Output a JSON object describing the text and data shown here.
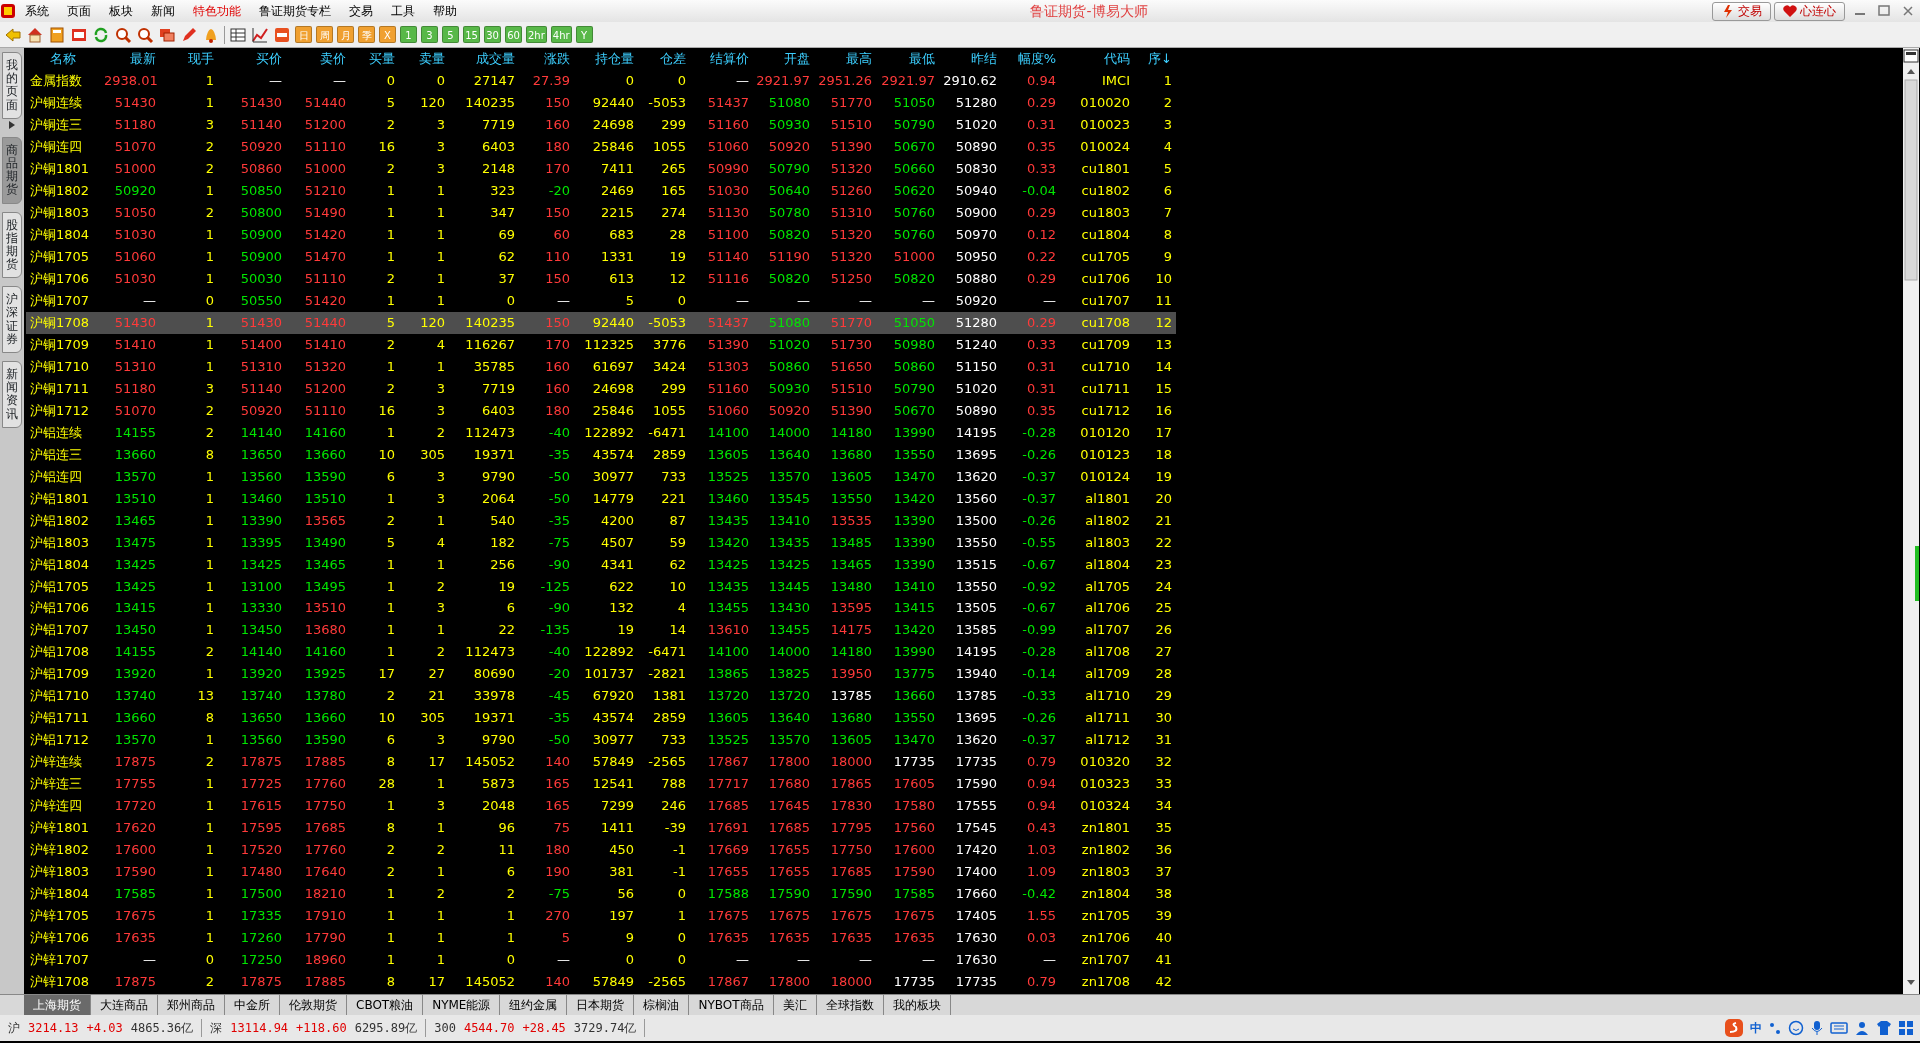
{
  "menu": [
    {
      "label": "系统",
      "selected": false
    },
    {
      "label": "页面",
      "selected": false
    },
    {
      "label": "板块",
      "selected": false
    },
    {
      "label": "新闻",
      "selected": false
    },
    {
      "label": "特色功能",
      "selected": true
    },
    {
      "label": "鲁证期货专栏",
      "selected": false
    },
    {
      "label": "交易",
      "selected": false
    },
    {
      "label": "工具",
      "selected": false
    },
    {
      "label": "帮助",
      "selected": false
    }
  ],
  "window": {
    "title": "鲁证期货-博易大师"
  },
  "title_buttons": [
    "交易",
    "心连心"
  ],
  "toolbar_periods": [
    {
      "label": "日",
      "color": "#f0a030"
    },
    {
      "label": "周",
      "color": "#f0a030"
    },
    {
      "label": "月",
      "color": "#f0a030"
    },
    {
      "label": "季",
      "color": "#f0a030"
    },
    {
      "label": "X",
      "color": "#f0a030"
    },
    {
      "label": "1",
      "color": "#58b848"
    },
    {
      "label": "3",
      "color": "#58b848"
    },
    {
      "label": "5",
      "color": "#58b848"
    },
    {
      "label": "15",
      "color": "#58b848"
    },
    {
      "label": "30",
      "color": "#58b848"
    },
    {
      "label": "60",
      "color": "#58b848"
    },
    {
      "label": "2hr",
      "color": "#58b848"
    },
    {
      "label": "4hr",
      "color": "#58b848"
    },
    {
      "label": "Y",
      "color": "#58b848"
    }
  ],
  "side_tabs": [
    {
      "label": "我的页面",
      "selected": false
    },
    {
      "label": "商品期货",
      "selected": true
    },
    {
      "label": "股指期货",
      "selected": false
    },
    {
      "label": "沪深证券",
      "selected": false
    },
    {
      "label": "新闻资讯",
      "selected": false
    }
  ],
  "table": {
    "columns": [
      "名称",
      "最新",
      "现手",
      "买价",
      "卖价",
      "买量",
      "卖量",
      "成交量",
      "涨跌",
      "持仓量",
      "仓差",
      "结算价",
      "开盘",
      "最高",
      "最低",
      "昨结",
      "幅度%",
      "代码",
      "序↓"
    ],
    "rows": [
      {
        "cells": [
          "金属指数",
          "2938.01",
          "1",
          "—",
          "—",
          "0",
          "0",
          "27147",
          "27.39",
          "0",
          "0",
          "—",
          "2921.97",
          "2951.26",
          "2921.97",
          "2910.62",
          "0.94",
          "IMCI",
          "1"
        ],
        "selected": false
      },
      {
        "cells": [
          "沪铜连续",
          "51430",
          "1",
          "51430",
          "51440",
          "5",
          "120",
          "140235",
          "150",
          "92440",
          "-5053",
          "51437",
          "51080",
          "51770",
          "51050",
          "51280",
          "0.29",
          "010020",
          "2"
        ],
        "selected": false
      },
      {
        "cells": [
          "沪铜连三",
          "51180",
          "3",
          "51140",
          "51200",
          "2",
          "3",
          "7719",
          "160",
          "24698",
          "299",
          "51160",
          "50930",
          "51510",
          "50790",
          "51020",
          "0.31",
          "010023",
          "3"
        ],
        "selected": false
      },
      {
        "cells": [
          "沪铜连四",
          "51070",
          "2",
          "50920",
          "51110",
          "16",
          "3",
          "6403",
          "180",
          "25846",
          "1055",
          "51060",
          "50920",
          "51390",
          "50670",
          "50890",
          "0.35",
          "010024",
          "4"
        ],
        "selected": false
      },
      {
        "cells": [
          "沪铜1801",
          "51000",
          "2",
          "50860",
          "51000",
          "2",
          "3",
          "2148",
          "170",
          "7411",
          "265",
          "50990",
          "50790",
          "51320",
          "50660",
          "50830",
          "0.33",
          "cu1801",
          "5"
        ],
        "selected": false
      },
      {
        "cells": [
          "沪铜1802",
          "50920",
          "1",
          "50850",
          "51210",
          "1",
          "1",
          "323",
          "-20",
          "2469",
          "165",
          "51030",
          "50640",
          "51260",
          "50620",
          "50940",
          "-0.04",
          "cu1802",
          "6"
        ],
        "selected": false
      },
      {
        "cells": [
          "沪铜1803",
          "51050",
          "2",
          "50800",
          "51490",
          "1",
          "1",
          "347",
          "150",
          "2215",
          "274",
          "51130",
          "50780",
          "51310",
          "50760",
          "50900",
          "0.29",
          "cu1803",
          "7"
        ],
        "selected": false
      },
      {
        "cells": [
          "沪铜1804",
          "51030",
          "1",
          "50900",
          "51420",
          "1",
          "1",
          "69",
          "60",
          "683",
          "28",
          "51100",
          "50820",
          "51320",
          "50760",
          "50970",
          "0.12",
          "cu1804",
          "8"
        ],
        "selected": false
      },
      {
        "cells": [
          "沪铜1705",
          "51060",
          "1",
          "50900",
          "51470",
          "1",
          "1",
          "62",
          "110",
          "1331",
          "19",
          "51140",
          "51190",
          "51320",
          "51000",
          "50950",
          "0.22",
          "cu1705",
          "9"
        ],
        "selected": false
      },
      {
        "cells": [
          "沪铜1706",
          "51030",
          "1",
          "50030",
          "51110",
          "2",
          "1",
          "37",
          "150",
          "613",
          "12",
          "51116",
          "50820",
          "51250",
          "50820",
          "50880",
          "0.29",
          "cu1706",
          "10"
        ],
        "selected": false
      },
      {
        "cells": [
          "沪铜1707",
          "—",
          "0",
          "50550",
          "51420",
          "1",
          "1",
          "0",
          "—",
          "5",
          "0",
          "—",
          "—",
          "—",
          "—",
          "50920",
          "—",
          "cu1707",
          "11"
        ],
        "selected": false
      },
      {
        "cells": [
          "沪铜1708",
          "51430",
          "1",
          "51430",
          "51440",
          "5",
          "120",
          "140235",
          "150",
          "92440",
          "-5053",
          "51437",
          "51080",
          "51770",
          "51050",
          "51280",
          "0.29",
          "cu1708",
          "12"
        ],
        "selected": true
      },
      {
        "cells": [
          "沪铜1709",
          "51410",
          "1",
          "51400",
          "51410",
          "2",
          "4",
          "116267",
          "170",
          "112325",
          "3776",
          "51390",
          "51020",
          "51730",
          "50980",
          "51240",
          "0.33",
          "cu1709",
          "13"
        ],
        "selected": false
      },
      {
        "cells": [
          "沪铜1710",
          "51310",
          "1",
          "51310",
          "51320",
          "1",
          "1",
          "35785",
          "160",
          "61697",
          "3424",
          "51303",
          "50860",
          "51650",
          "50860",
          "51150",
          "0.31",
          "cu1710",
          "14"
        ],
        "selected": false
      },
      {
        "cells": [
          "沪铜1711",
          "51180",
          "3",
          "51140",
          "51200",
          "2",
          "3",
          "7719",
          "160",
          "24698",
          "299",
          "51160",
          "50930",
          "51510",
          "50790",
          "51020",
          "0.31",
          "cu1711",
          "15"
        ],
        "selected": false
      },
      {
        "cells": [
          "沪铜1712",
          "51070",
          "2",
          "50920",
          "51110",
          "16",
          "3",
          "6403",
          "180",
          "25846",
          "1055",
          "51060",
          "50920",
          "51390",
          "50670",
          "50890",
          "0.35",
          "cu1712",
          "16"
        ],
        "selected": false
      },
      {
        "cells": [
          "沪铝连续",
          "14155",
          "2",
          "14140",
          "14160",
          "1",
          "2",
          "112473",
          "-40",
          "122892",
          "-6471",
          "14100",
          "14000",
          "14180",
          "13990",
          "14195",
          "-0.28",
          "010120",
          "17"
        ],
        "selected": false
      },
      {
        "cells": [
          "沪铝连三",
          "13660",
          "8",
          "13650",
          "13660",
          "10",
          "305",
          "19371",
          "-35",
          "43574",
          "2859",
          "13605",
          "13640",
          "13680",
          "13550",
          "13695",
          "-0.26",
          "010123",
          "18"
        ],
        "selected": false
      },
      {
        "cells": [
          "沪铝连四",
          "13570",
          "1",
          "13560",
          "13590",
          "6",
          "3",
          "9790",
          "-50",
          "30977",
          "733",
          "13525",
          "13570",
          "13605",
          "13470",
          "13620",
          "-0.37",
          "010124",
          "19"
        ],
        "selected": false
      },
      {
        "cells": [
          "沪铝1801",
          "13510",
          "1",
          "13460",
          "13510",
          "1",
          "3",
          "2064",
          "-50",
          "14779",
          "221",
          "13460",
          "13545",
          "13550",
          "13420",
          "13560",
          "-0.37",
          "al1801",
          "20"
        ],
        "selected": false
      },
      {
        "cells": [
          "沪铝1802",
          "13465",
          "1",
          "13390",
          "13565",
          "2",
          "1",
          "540",
          "-35",
          "4200",
          "87",
          "13435",
          "13410",
          "13535",
          "13390",
          "13500",
          "-0.26",
          "al1802",
          "21"
        ],
        "selected": false
      },
      {
        "cells": [
          "沪铝1803",
          "13475",
          "1",
          "13395",
          "13490",
          "5",
          "4",
          "182",
          "-75",
          "4507",
          "59",
          "13420",
          "13435",
          "13485",
          "13390",
          "13550",
          "-0.55",
          "al1803",
          "22"
        ],
        "selected": false
      },
      {
        "cells": [
          "沪铝1804",
          "13425",
          "1",
          "13425",
          "13465",
          "1",
          "1",
          "256",
          "-90",
          "4341",
          "62",
          "13425",
          "13425",
          "13465",
          "13390",
          "13515",
          "-0.67",
          "al1804",
          "23"
        ],
        "selected": false
      },
      {
        "cells": [
          "沪铝1705",
          "13425",
          "1",
          "13100",
          "13495",
          "1",
          "2",
          "19",
          "-125",
          "622",
          "10",
          "13435",
          "13445",
          "13480",
          "13410",
          "13550",
          "-0.92",
          "al1705",
          "24"
        ],
        "selected": false
      },
      {
        "cells": [
          "沪铝1706",
          "13415",
          "1",
          "13330",
          "13510",
          "1",
          "3",
          "6",
          "-90",
          "132",
          "4",
          "13455",
          "13430",
          "13595",
          "13415",
          "13505",
          "-0.67",
          "al1706",
          "25"
        ],
        "selected": false
      },
      {
        "cells": [
          "沪铝1707",
          "13450",
          "1",
          "13450",
          "13680",
          "1",
          "1",
          "22",
          "-135",
          "19",
          "14",
          "13610",
          "13455",
          "14175",
          "13420",
          "13585",
          "-0.99",
          "al1707",
          "26"
        ],
        "selected": false
      },
      {
        "cells": [
          "沪铝1708",
          "14155",
          "2",
          "14140",
          "14160",
          "1",
          "2",
          "112473",
          "-40",
          "122892",
          "-6471",
          "14100",
          "14000",
          "14180",
          "13990",
          "14195",
          "-0.28",
          "al1708",
          "27"
        ],
        "selected": false
      },
      {
        "cells": [
          "沪铝1709",
          "13920",
          "1",
          "13920",
          "13925",
          "17",
          "27",
          "80690",
          "-20",
          "101737",
          "-2821",
          "13865",
          "13825",
          "13950",
          "13775",
          "13940",
          "-0.14",
          "al1709",
          "28"
        ],
        "selected": false
      },
      {
        "cells": [
          "沪铝1710",
          "13740",
          "13",
          "13740",
          "13780",
          "2",
          "21",
          "33978",
          "-45",
          "67920",
          "1381",
          "13720",
          "13720",
          "13785",
          "13660",
          "13785",
          "-0.33",
          "al1710",
          "29"
        ],
        "selected": false
      },
      {
        "cells": [
          "沪铝1711",
          "13660",
          "8",
          "13650",
          "13660",
          "10",
          "305",
          "19371",
          "-35",
          "43574",
          "2859",
          "13605",
          "13640",
          "13680",
          "13550",
          "13695",
          "-0.26",
          "al1711",
          "30"
        ],
        "selected": false
      },
      {
        "cells": [
          "沪铝1712",
          "13570",
          "1",
          "13560",
          "13590",
          "6",
          "3",
          "9790",
          "-50",
          "30977",
          "733",
          "13525",
          "13570",
          "13605",
          "13470",
          "13620",
          "-0.37",
          "al1712",
          "31"
        ],
        "selected": false
      },
      {
        "cells": [
          "沪锌连续",
          "17875",
          "2",
          "17875",
          "17885",
          "8",
          "17",
          "145052",
          "140",
          "57849",
          "-2565",
          "17867",
          "17800",
          "18000",
          "17735",
          "17735",
          "0.79",
          "010320",
          "32"
        ],
        "selected": false
      },
      {
        "cells": [
          "沪锌连三",
          "17755",
          "1",
          "17725",
          "17760",
          "28",
          "1",
          "5873",
          "165",
          "12541",
          "788",
          "17717",
          "17680",
          "17865",
          "17605",
          "17590",
          "0.94",
          "010323",
          "33"
        ],
        "selected": false
      },
      {
        "cells": [
          "沪锌连四",
          "17720",
          "1",
          "17615",
          "17750",
          "1",
          "3",
          "2048",
          "165",
          "7299",
          "246",
          "17685",
          "17645",
          "17830",
          "17580",
          "17555",
          "0.94",
          "010324",
          "34"
        ],
        "selected": false
      },
      {
        "cells": [
          "沪锌1801",
          "17620",
          "1",
          "17595",
          "17685",
          "8",
          "1",
          "96",
          "75",
          "1411",
          "-39",
          "17691",
          "17685",
          "17795",
          "17560",
          "17545",
          "0.43",
          "zn1801",
          "35"
        ],
        "selected": false
      },
      {
        "cells": [
          "沪锌1802",
          "17600",
          "1",
          "17520",
          "17760",
          "2",
          "2",
          "11",
          "180",
          "450",
          "-1",
          "17669",
          "17655",
          "17750",
          "17600",
          "17420",
          "1.03",
          "zn1802",
          "36"
        ],
        "selected": false
      },
      {
        "cells": [
          "沪锌1803",
          "17590",
          "1",
          "17480",
          "17640",
          "2",
          "1",
          "6",
          "190",
          "381",
          "-1",
          "17655",
          "17655",
          "17685",
          "17590",
          "17400",
          "1.09",
          "zn1803",
          "37"
        ],
        "selected": false
      },
      {
        "cells": [
          "沪锌1804",
          "17585",
          "1",
          "17500",
          "18210",
          "1",
          "2",
          "2",
          "-75",
          "56",
          "0",
          "17588",
          "17590",
          "17590",
          "17585",
          "17660",
          "-0.42",
          "zn1804",
          "38"
        ],
        "selected": false
      },
      {
        "cells": [
          "沪锌1705",
          "17675",
          "1",
          "17335",
          "17910",
          "1",
          "1",
          "1",
          "270",
          "197",
          "1",
          "17675",
          "17675",
          "17675",
          "17675",
          "17405",
          "1.55",
          "zn1705",
          "39"
        ],
        "selected": false
      },
      {
        "cells": [
          "沪锌1706",
          "17635",
          "1",
          "17260",
          "17790",
          "1",
          "1",
          "1",
          "5",
          "9",
          "0",
          "17635",
          "17635",
          "17635",
          "17635",
          "17630",
          "0.03",
          "zn1706",
          "40"
        ],
        "selected": false
      },
      {
        "cells": [
          "沪锌1707",
          "—",
          "0",
          "17250",
          "18960",
          "1",
          "1",
          "0",
          "—",
          "0",
          "0",
          "—",
          "—",
          "—",
          "—",
          "17630",
          "—",
          "zn1707",
          "41"
        ],
        "selected": false
      },
      {
        "cells": [
          "沪锌1708",
          "17875",
          "2",
          "17875",
          "17885",
          "8",
          "17",
          "145052",
          "140",
          "57849",
          "-2565",
          "17867",
          "17800",
          "18000",
          "17735",
          "17735",
          "0.79",
          "zn1708",
          "42"
        ],
        "selected": false
      }
    ]
  },
  "bottom_tabs": [
    {
      "label": "上海期货",
      "selected": true
    },
    {
      "label": "大连商品",
      "selected": false
    },
    {
      "label": "郑州商品",
      "selected": false
    },
    {
      "label": "中金所",
      "selected": false
    },
    {
      "label": "伦敦期货",
      "selected": false
    },
    {
      "label": "CBOT粮油",
      "selected": false
    },
    {
      "label": "NYME能源",
      "selected": false
    },
    {
      "label": "纽约金属",
      "selected": false
    },
    {
      "label": "日本期货",
      "selected": false
    },
    {
      "label": "棕榈油",
      "selected": false
    },
    {
      "label": "NYBOT商品",
      "selected": false
    },
    {
      "label": "美汇",
      "selected": false
    },
    {
      "label": "全球指数",
      "selected": false
    },
    {
      "label": "我的板块",
      "selected": false
    }
  ],
  "status_bar": {
    "indices": [
      {
        "market": "沪",
        "value": "3214.13",
        "change": "+4.03",
        "amount": "4865.36亿"
      },
      {
        "market": "深",
        "value": "13114.94",
        "change": "+118.60",
        "amount": "6295.89亿"
      },
      {
        "market": "300",
        "value": "4544.70",
        "change": "+28.45",
        "amount": "3729.74亿"
      }
    ],
    "input_method": "中"
  }
}
